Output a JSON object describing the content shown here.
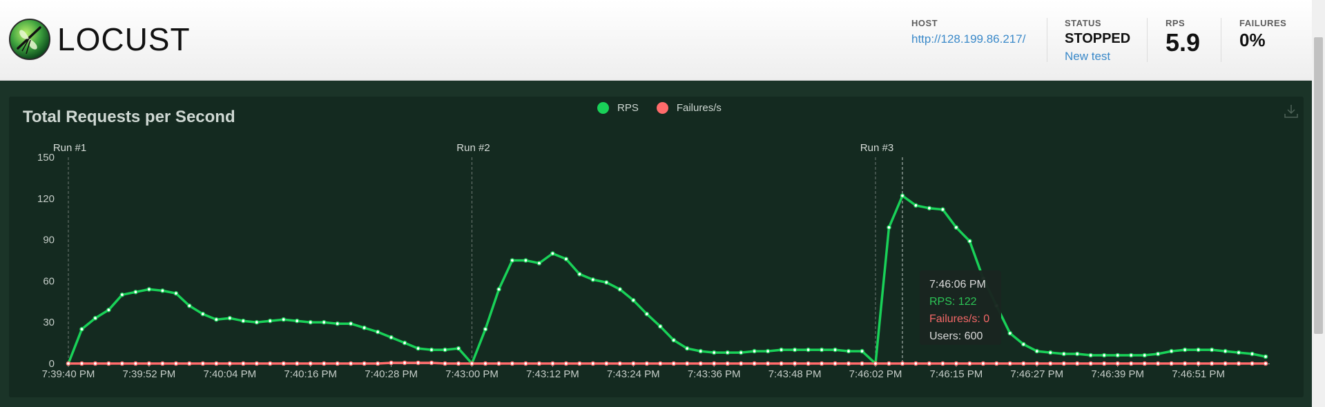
{
  "header": {
    "brand": "LOCUST",
    "host_label": "HOST",
    "host_value": "http://128.199.86.217/",
    "status_label": "STATUS",
    "status_value": "STOPPED",
    "new_test_label": "New test",
    "rps_label": "RPS",
    "rps_value": "5.9",
    "failures_label": "FAILURES",
    "failures_value": "0%"
  },
  "colors": {
    "rps": "#19d158",
    "failures": "#ff6b6b",
    "panel": "#142a20",
    "background": "#1b3428"
  },
  "icons": {
    "logo": "locust-dragonfly-logo",
    "download": "download-icon"
  },
  "tooltip": {
    "time": "7:46:06 PM",
    "rps": "RPS: 122",
    "failures": "Failures/s: 0",
    "users": "Users: 600"
  },
  "chart_data": {
    "type": "line",
    "title": "Total Requests per Second",
    "legend": [
      "RPS",
      "Failures/s"
    ],
    "legend_position": "top-center",
    "ylim": [
      0,
      150
    ],
    "yticks": [
      0,
      30,
      60,
      90,
      120,
      150
    ],
    "x_tick_labels": [
      "7:39:40 PM",
      "7:39:52 PM",
      "7:40:04 PM",
      "7:40:16 PM",
      "7:40:28 PM",
      "7:43:00 PM",
      "7:43:12 PM",
      "7:43:24 PM",
      "7:43:36 PM",
      "7:43:48 PM",
      "7:46:02 PM",
      "7:46:15 PM",
      "7:46:27 PM",
      "7:46:39 PM",
      "7:46:51 PM"
    ],
    "markers": [
      {
        "label": "Run #1",
        "at_point": 0
      },
      {
        "label": "Run #2",
        "at_point": 30
      },
      {
        "label": "Run #3",
        "at_point": 60
      }
    ],
    "hover_point": 62,
    "series": [
      {
        "name": "RPS",
        "values": [
          0,
          25,
          33,
          39,
          50,
          52,
          54,
          53,
          51,
          42,
          36,
          32,
          33,
          31,
          30,
          31,
          32,
          31,
          30,
          30,
          29,
          29,
          26,
          23,
          19,
          15,
          11,
          10,
          10,
          11,
          0,
          25,
          54,
          75,
          75,
          73,
          80,
          76,
          65,
          61,
          59,
          54,
          46,
          36,
          27,
          17,
          11,
          9,
          8,
          8,
          8,
          9,
          9,
          10,
          10,
          10,
          10,
          10,
          9,
          9,
          0,
          99,
          122,
          115,
          113,
          112,
          99,
          89,
          62,
          42,
          22,
          14,
          9,
          8,
          7,
          7,
          6,
          6,
          6,
          6,
          6,
          7,
          9,
          10,
          10,
          10,
          9,
          8,
          7,
          5
        ]
      },
      {
        "name": "Failures/s",
        "values": [
          0,
          0,
          0,
          0,
          0,
          0,
          0,
          0,
          0,
          0,
          0,
          0,
          0,
          0,
          0,
          0,
          0,
          0,
          0,
          0,
          0,
          0,
          0,
          0,
          0.5,
          0.5,
          0.5,
          0.5,
          0,
          0,
          0,
          0,
          0,
          0,
          0,
          0,
          0,
          0,
          0,
          0,
          0,
          0,
          0,
          0,
          0,
          0,
          0,
          0,
          0,
          0,
          0,
          0,
          0,
          0,
          0,
          0,
          0,
          0,
          0,
          0,
          0,
          0,
          0,
          0,
          0,
          0,
          0,
          0,
          0,
          0,
          0,
          0,
          0,
          0,
          0,
          0,
          0,
          0,
          0,
          0,
          0,
          0,
          0,
          0,
          0,
          0,
          0,
          0,
          0,
          0
        ]
      }
    ]
  }
}
